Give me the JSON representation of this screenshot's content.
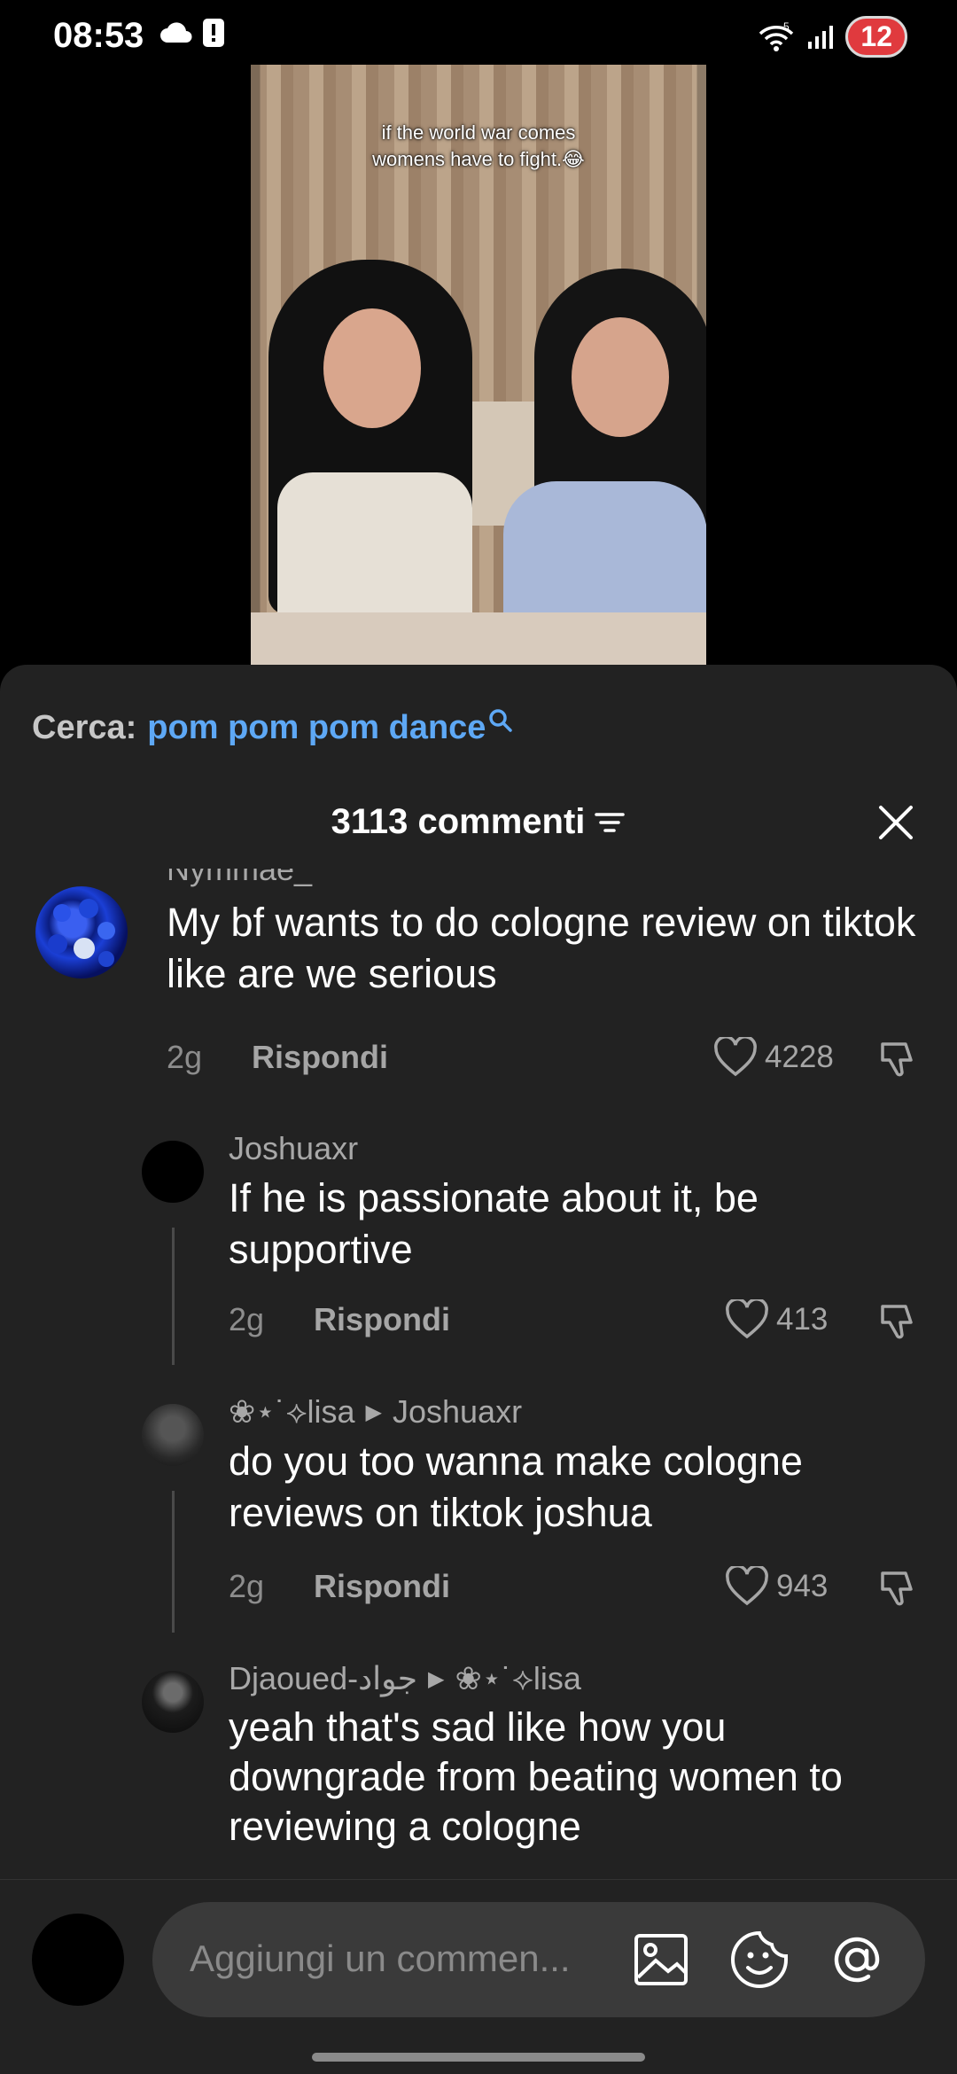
{
  "status_bar": {
    "time": "08:53",
    "battery": "12"
  },
  "video": {
    "caption_line1": "if the world war comes",
    "caption_line2": "womens have to fight.😂"
  },
  "search": {
    "prefix": "Cerca:",
    "query": "pom pom pom dance"
  },
  "header": {
    "count_label": "3113 commenti"
  },
  "comments": [
    {
      "user": "Nymmae_",
      "text": "My bf wants to do cologne review on tiktok like are we serious",
      "age": "2g",
      "reply_label": "Rispondi",
      "likes": "4228"
    },
    {
      "user": "Joshuaxr",
      "text": "If he is passionate about it, be supportive",
      "age": "2g",
      "reply_label": "Rispondi",
      "likes": "413"
    },
    {
      "user": "❀⋆˙⟡lisa",
      "reply_to": "Joshuaxr",
      "text": "do you too wanna make cologne reviews on tiktok joshua",
      "age": "2g",
      "reply_label": "Rispondi",
      "likes": "943"
    },
    {
      "user": "Djaoued-جواد",
      "reply_to": "❀⋆˙⟡lisa",
      "text": "yeah that's sad like how you downgrade from beating women to reviewing a cologne"
    }
  ],
  "composer": {
    "placeholder": "Aggiungi un commen..."
  },
  "colors": {
    "sheet_bg": "#222222",
    "link_blue": "#5ea8f5",
    "battery_red": "#e03a3e"
  },
  "icons": [
    "cloud-icon",
    "alert-icon",
    "wifi-icon",
    "signal-icon",
    "search-icon",
    "sort-icon",
    "close-icon",
    "heart-icon",
    "thumbs-down-icon",
    "image-icon",
    "emoji-icon",
    "mention-icon"
  ]
}
